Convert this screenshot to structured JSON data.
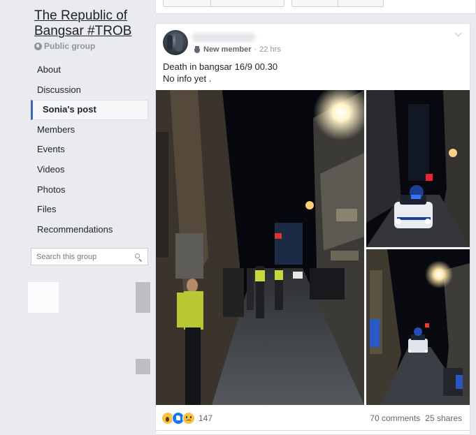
{
  "group": {
    "title": "The Republic of Bangsar #TROB",
    "privacy": "Public group",
    "privacy_icon": "globe-icon"
  },
  "nav": {
    "items": [
      {
        "label": "About"
      },
      {
        "label": "Discussion"
      },
      {
        "label": "Sonia's post",
        "active": true
      },
      {
        "label": "Members"
      },
      {
        "label": "Events"
      },
      {
        "label": "Videos"
      },
      {
        "label": "Photos"
      },
      {
        "label": "Files"
      },
      {
        "label": "Recommendations"
      }
    ]
  },
  "search": {
    "placeholder": "Search this group",
    "icon": "search-icon"
  },
  "post": {
    "badge": "New member",
    "badge_icon": "hand-icon",
    "separator": "·",
    "time": "22 hrs",
    "text_line1": "Death in bangsar 16/9 00.30",
    "text_line2": "No info yet .",
    "reactions": {
      "icons": [
        "wow-icon",
        "like-icon",
        "sad-icon"
      ],
      "count": "147"
    },
    "comments": "70 comments",
    "shares": "25 shares"
  },
  "colors": {
    "page_bg": "#e9ebee",
    "card_bg": "#ffffff",
    "text": "#1d2129",
    "muted": "#90949c",
    "accent": "#4267b2"
  }
}
